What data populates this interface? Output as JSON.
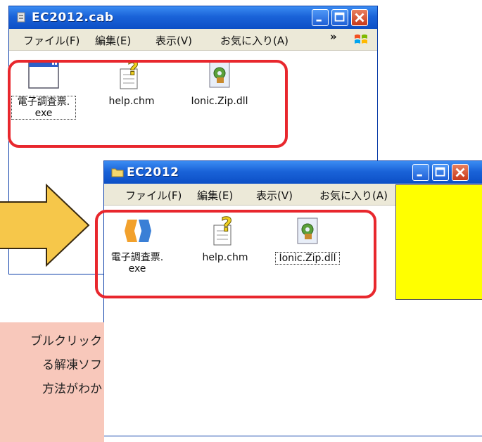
{
  "window_back": {
    "title": "EC2012.cab",
    "menu": [
      "ファイル(F)",
      "編集(E)",
      "表示(V)",
      "お気に入り(A)"
    ],
    "menu_more": "»",
    "files": [
      {
        "name": "電子調査票.",
        "ext": "exe",
        "icon": "app-window-icon"
      },
      {
        "name": "help.chm",
        "icon": "help-file-icon"
      },
      {
        "name": "Ionic.Zip.dll",
        "icon": "dll-gear-icon"
      }
    ]
  },
  "window_front": {
    "title": "EC2012",
    "menu": [
      "ファイル(F)",
      "編集(E)",
      "表示(V)",
      "お気に入り(A)"
    ],
    "files": [
      {
        "name": "電子調査票.",
        "ext": "exe",
        "icon": "executable-app-icon"
      },
      {
        "name": "help.chm",
        "icon": "help-file-icon"
      },
      {
        "name": "Ionic.Zip.dll",
        "icon": "dll-gear-icon"
      }
    ]
  },
  "note_lines": [
    "ブルクリック",
    "る解凍ソフ",
    "方法がわか"
  ],
  "colors": {
    "highlight": "#e8272d",
    "arrow": "#f6c74a",
    "note_bg": "#f8c8bb",
    "yellow_box": "#ffff00"
  }
}
